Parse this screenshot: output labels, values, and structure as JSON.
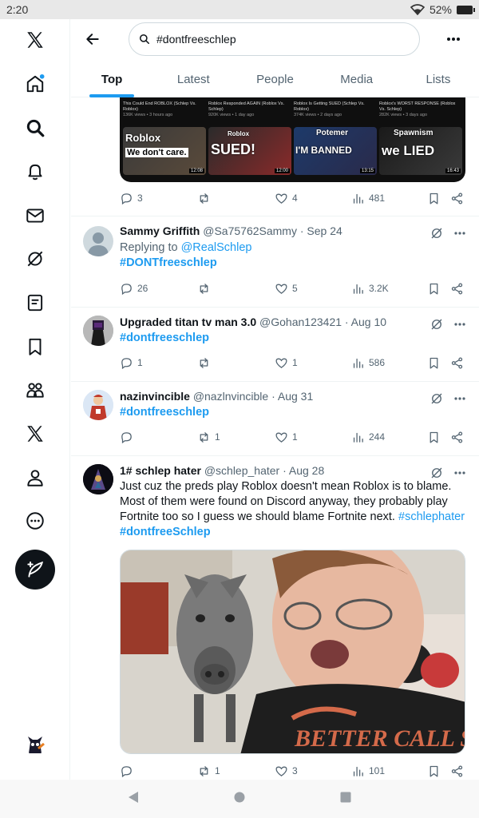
{
  "status": {
    "time": "2:20",
    "battery": "52%"
  },
  "search": {
    "query": "#dontfreeschlep"
  },
  "tabs": [
    {
      "label": "Top"
    },
    {
      "label": "Latest"
    },
    {
      "label": "People"
    },
    {
      "label": "Media"
    },
    {
      "label": "Lists"
    }
  ],
  "sidebar": {
    "icons": [
      "x-logo-icon",
      "home-icon",
      "explore-icon",
      "notifications-icon",
      "messages-icon",
      "grok-icon",
      "lists-icon",
      "bookmarks-icon",
      "communities-icon",
      "premium-icon",
      "profile-icon",
      "more-icon"
    ],
    "compose_icon": "compose-post-icon"
  },
  "top_tweet": {
    "thumbs": [
      {
        "meta": "This Could End ROBLOX (Schlep Vs. Roblox)",
        "views": "136K views • 3 hours ago",
        "big": "Roblox",
        "sub": "We don't care.",
        "time": "12:08"
      },
      {
        "meta": "Roblox Responded AGAIN (Roblox Vs. Schlep)",
        "views": "920K views • 1 day ago",
        "big": "SUED!",
        "sub": "Roblox",
        "time": "12:00"
      },
      {
        "meta": "Roblox Is Getting SUED (Schlep Vs. Roblox)",
        "views": "374K views • 2 days ago",
        "big": "I'M BANNED",
        "sub": "Potemer",
        "time": "13:15"
      },
      {
        "meta": "Roblox's WORST RESPONSE (Roblox Vs. Schlep)",
        "views": "282K views • 3 days ago",
        "big": "we LIED",
        "sub": "Spawnism",
        "time": "16:43"
      }
    ],
    "replies": "3",
    "reposts": "",
    "likes": "4",
    "views": "481"
  },
  "tweets": [
    {
      "name": "Sammy Griffith",
      "handle": "@Sa75762Sammy · Sep 24",
      "replying_prefix": "Replying to ",
      "replying_to": "@RealSchlep",
      "hashtag": "#DONTfreeschlep",
      "replies": "26",
      "reposts": "",
      "likes": "5",
      "views": "3.2K"
    },
    {
      "name": "Upgraded titan tv man 3.0",
      "handle": "@Gohan123421 · Aug 10",
      "hashtag": "#dontfreeschlep",
      "replies": "1",
      "reposts": "",
      "likes": "1",
      "views": "586"
    },
    {
      "name": "nazinvincible",
      "handle": "@nazlnvincible · Aug 31",
      "hashtag": "#dontfreeschlep",
      "replies": "",
      "reposts": "1",
      "likes": "1",
      "views": "244"
    },
    {
      "name": "1# schlep hater",
      "handle": "@schlep_hater · Aug 28",
      "text_1": "Just cuz the preds play Roblox doesn't mean Roblox is to blame.",
      "text_2": "Most of them were found on Discord anyway, they probably play",
      "text_3": "Fortnite too so I guess we should blame Fortnite next.",
      "inline_tag": "#schlephater",
      "hashtag": "#dontfreeSchlep",
      "replies": "",
      "reposts": "1",
      "likes": "3",
      "views": "101",
      "media_text": "BETTER CALL Saul"
    }
  ],
  "colors": {
    "accent": "#1d9bf0",
    "text": "#0f1419",
    "muted": "#536471",
    "border": "#eff3f4"
  }
}
